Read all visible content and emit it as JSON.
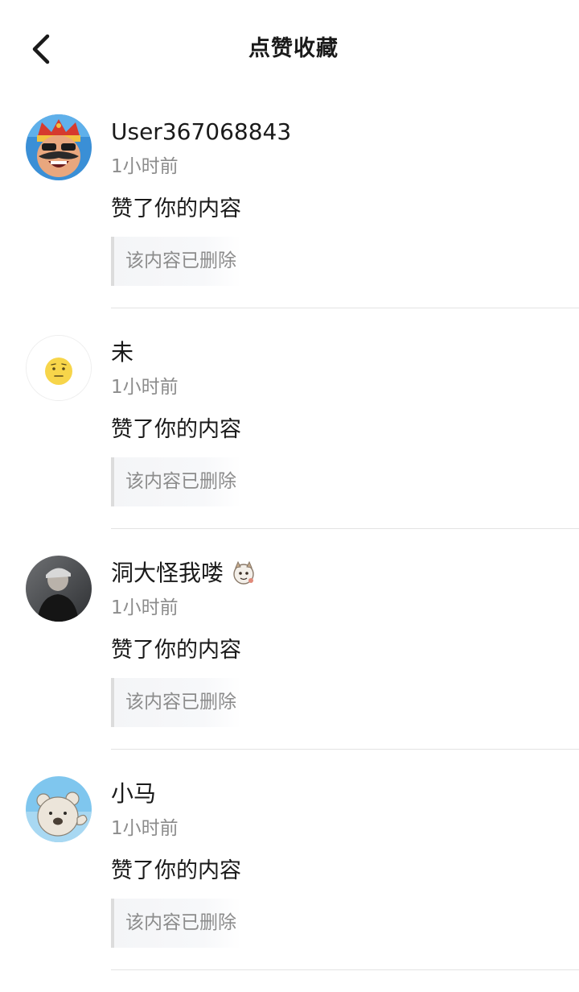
{
  "header": {
    "title": "点赞收藏",
    "back_icon": "chevron-left-icon"
  },
  "notifications": [
    {
      "username": "User367068843",
      "time": "1小时前",
      "action": "赞了你的内容",
      "quote": "该内容已删除",
      "avatar": "king-cartoon-avatar"
    },
    {
      "username": "未",
      "time": "1小时前",
      "action": "赞了你的内容",
      "quote": "该内容已删除",
      "avatar": "emoji-face-avatar"
    },
    {
      "username": "洞大怪我喽",
      "time": "1小时前",
      "action": "赞了你的内容",
      "quote": "该内容已删除",
      "avatar": "person-photo-avatar",
      "badge": "cartoon-character-badge-icon"
    },
    {
      "username": "小马",
      "time": "1小时前",
      "action": "赞了你的内容",
      "quote": "该内容已删除",
      "avatar": "bear-cartoon-avatar"
    }
  ]
}
